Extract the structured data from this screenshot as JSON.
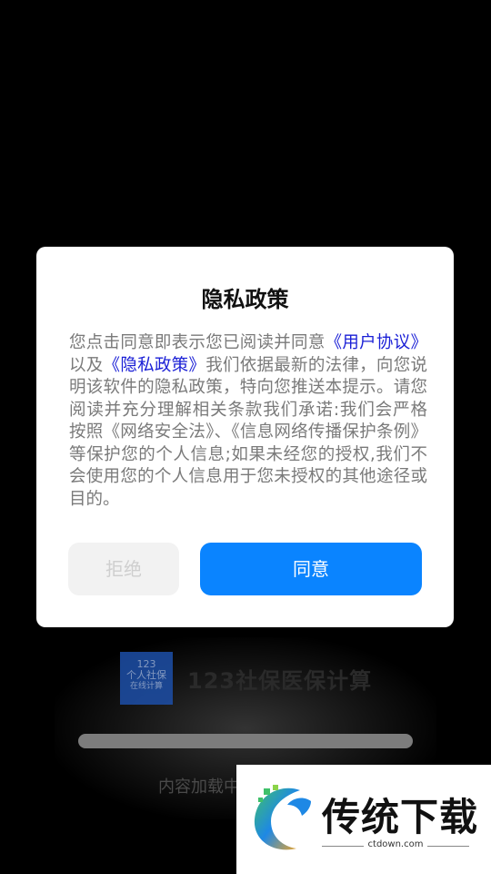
{
  "splash": {
    "logo_line1": "123",
    "logo_line2": "个人社保",
    "logo_line3": "在线计算",
    "app_name": "123社保医保计算",
    "loading_text": "内容加载中..."
  },
  "dialog": {
    "title": "隐私政策",
    "body_part1": "您点击同意即表示您已阅读并同意",
    "link_user_agreement": "《用户协议》",
    "body_part2": "以及",
    "link_privacy_policy": "《隐私政策》",
    "body_part3": "我们依据最新的法律，向您说明该软件的隐私政策，特向您推送本提示。请您阅读并充分理解相关条款我们承诺:我们会严格按照《网络安全法》、《信息网络传播保护条例》等保护您的个人信息;如果未经您的授权,我们不会使用您的个人信息用于您未授权的其他途径或目的。",
    "reject_label": "拒绝",
    "agree_label": "同意"
  },
  "watermark": {
    "title": "传统下载",
    "url": "ctdown.com"
  },
  "colors": {
    "agree_button": "#0a84ff",
    "link": "#1a1fd6",
    "reject_bg": "#f2f2f2"
  }
}
